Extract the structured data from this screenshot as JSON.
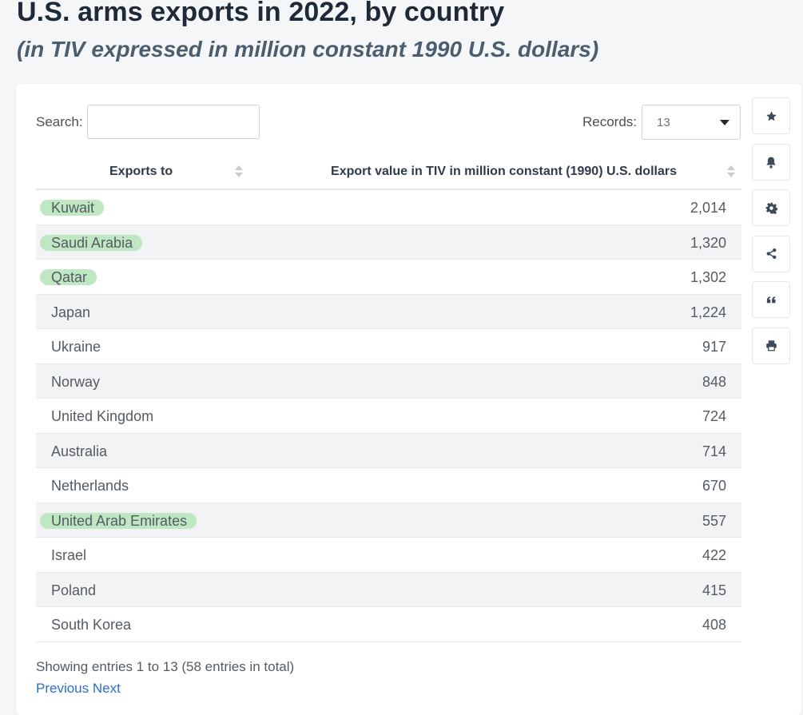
{
  "page": {
    "title": "U.S. arms exports in 2022, by country",
    "subtitle": "(in TIV expressed in million constant 1990 U.S. dollars)"
  },
  "controls": {
    "search_label": "Search:",
    "search_value": "",
    "records_label": "Records:",
    "records_value": "13"
  },
  "table": {
    "headers": {
      "country": "Exports to",
      "value": "Export value in TIV in million constant (1990) U.S. dollars"
    },
    "rows": [
      {
        "country": "Kuwait",
        "value": "2,014",
        "highlighted": true
      },
      {
        "country": "Saudi Arabia",
        "value": "1,320",
        "highlighted": true
      },
      {
        "country": "Qatar",
        "value": "1,302",
        "highlighted": true
      },
      {
        "country": "Japan",
        "value": "1,224",
        "highlighted": false
      },
      {
        "country": "Ukraine",
        "value": "917",
        "highlighted": false
      },
      {
        "country": "Norway",
        "value": "848",
        "highlighted": false
      },
      {
        "country": "United Kingdom",
        "value": "724",
        "highlighted": false
      },
      {
        "country": "Australia",
        "value": "714",
        "highlighted": false
      },
      {
        "country": "Netherlands",
        "value": "670",
        "highlighted": false
      },
      {
        "country": "United Arab Emirates",
        "value": "557",
        "highlighted": true
      },
      {
        "country": "Israel",
        "value": "422",
        "highlighted": false
      },
      {
        "country": "Poland",
        "value": "415",
        "highlighted": false
      },
      {
        "country": "South Korea",
        "value": "408",
        "highlighted": false
      }
    ]
  },
  "footer": {
    "info": "Showing entries 1 to 13 (58 entries in total)",
    "previous": "Previous",
    "next": "Next"
  },
  "toolbar": {
    "icons": [
      "star-icon",
      "bell-icon",
      "gear-icon",
      "share-icon",
      "quote-icon",
      "print-icon"
    ]
  },
  "colors": {
    "highlight": "#bfe8c2",
    "link": "#2c6fc7",
    "title": "#1e2a38",
    "icon": "#3d4a5c"
  }
}
